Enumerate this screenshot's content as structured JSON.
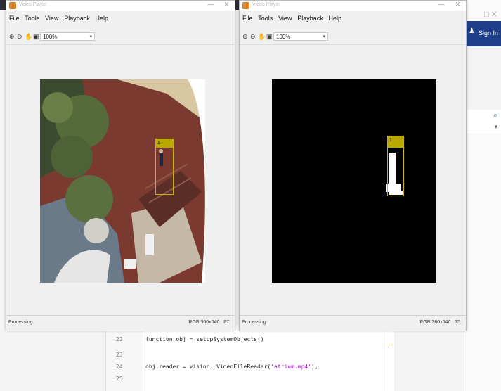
{
  "app": {
    "right_sign_in": "Sign In"
  },
  "player_left": {
    "title": "Video Player",
    "menu": [
      "File",
      "Tools",
      "View",
      "Playback",
      "Help"
    ],
    "zoom_value": "100%",
    "status_left": "Processing",
    "status_right": "RGB:360x640",
    "frame_number": "87",
    "bbox_label": "1"
  },
  "player_right": {
    "title": "Video Player",
    "menu": [
      "File",
      "Tools",
      "View",
      "Playback",
      "Help"
    ],
    "zoom_value": "100%",
    "status_left": "Processing",
    "status_right": "RGB:360x640",
    "frame_number": "75",
    "bbox_label": "1"
  },
  "editor": {
    "lines": [
      {
        "num": "22",
        "text": "function obj = setupSystemObjects()",
        "str": ""
      },
      {
        "num": "23",
        "text": "",
        "str": ""
      },
      {
        "num": "24 -",
        "text": "obj.reader = vision. VideoFileReader(",
        "str": "'atrium.mp4'",
        "tail": ");"
      },
      {
        "num": "25",
        "text": "",
        "str": ""
      }
    ]
  },
  "colors": {
    "bbox_fill": "#b8a800",
    "bbox_stroke": "#c8b400",
    "mask_bg": "#000000",
    "mask_fg": "#ffffff",
    "toolbar_blue": "#1e3f8a",
    "string_purple": "#a010c8"
  }
}
